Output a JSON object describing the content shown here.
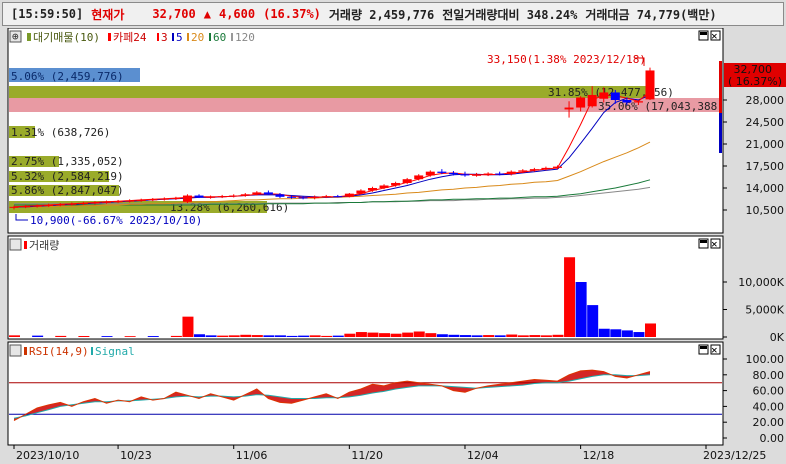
{
  "header": {
    "time": "[15:59:50]",
    "price_label": "현재가",
    "price": "32,700",
    "arrow": "▲",
    "change": "4,600",
    "change_pct": "(16.37%)",
    "volume": "거래량 2,459,776",
    "vol_ratio": "전일거래량대비 348.24%",
    "amount": "거래대금 74,779(백만)"
  },
  "price_pane": {
    "legend": [
      "대기매물(10)",
      "카페24",
      "3",
      "5",
      "20",
      "60",
      "120"
    ],
    "ylabels": [
      "28,000",
      "24,500",
      "21,000",
      "17,500",
      "14,000",
      "10,500"
    ],
    "current_price": "32,700",
    "current_pct": "( 16.37%)",
    "high_note": "33,150(1.38% 2023/12/18)",
    "low_note": "10,900(-66.67% 2023/10/10)",
    "supply_bars": [
      {
        "label": "5.06% (2,459,776)"
      },
      {
        "label": "31.85% (12,477,056)"
      },
      {
        "label": "35.06% (17,043,388)"
      },
      {
        "label": "1.31% (638,726)"
      },
      {
        "label": "2.75% (1,335,052)"
      },
      {
        "label": "5.32% (2,584,219)"
      },
      {
        "label": "5.86% (2,847,047)"
      },
      {
        "label": "13.28% (6,260,616)"
      }
    ],
    "candles": [
      [
        10.9,
        11.2,
        10.6,
        11.0
      ],
      [
        11.0,
        11.3,
        10.8,
        11.1
      ],
      [
        11.1,
        11.4,
        10.9,
        11.2
      ],
      [
        11.2,
        11.5,
        11.0,
        11.3
      ],
      [
        11.3,
        11.6,
        11.1,
        11.4
      ],
      [
        11.4,
        11.7,
        11.2,
        11.5
      ],
      [
        11.5,
        11.8,
        11.3,
        11.6
      ],
      [
        11.6,
        11.9,
        11.4,
        11.7
      ],
      [
        11.7,
        12.0,
        11.5,
        11.8
      ],
      [
        11.8,
        12.1,
        11.6,
        11.9
      ],
      [
        11.9,
        12.2,
        11.7,
        12.0
      ],
      [
        12.0,
        12.3,
        11.8,
        12.1
      ],
      [
        12.1,
        12.4,
        11.9,
        12.2
      ],
      [
        12.2,
        12.5,
        12.0,
        12.3
      ],
      [
        12.3,
        12.6,
        12.1,
        12.4
      ],
      [
        11.8,
        13.0,
        11.6,
        12.8
      ],
      [
        12.8,
        13.0,
        12.4,
        12.5
      ],
      [
        12.5,
        12.8,
        12.3,
        12.6
      ],
      [
        12.6,
        12.9,
        12.4,
        12.7
      ],
      [
        12.7,
        13.0,
        12.5,
        12.8
      ],
      [
        12.8,
        13.2,
        12.6,
        13.0
      ],
      [
        13.0,
        13.5,
        12.8,
        13.3
      ],
      [
        13.3,
        13.6,
        12.9,
        13.0
      ],
      [
        13.0,
        13.2,
        12.4,
        12.6
      ],
      [
        12.6,
        12.8,
        12.3,
        12.5
      ],
      [
        12.5,
        12.7,
        12.2,
        12.4
      ],
      [
        12.4,
        12.8,
        12.2,
        12.6
      ],
      [
        12.6,
        12.9,
        12.4,
        12.7
      ],
      [
        12.7,
        12.9,
        12.5,
        12.6
      ],
      [
        12.6,
        13.2,
        12.5,
        13.1
      ],
      [
        13.1,
        13.8,
        13.0,
        13.6
      ],
      [
        13.6,
        14.2,
        13.4,
        14.0
      ],
      [
        14.0,
        14.6,
        13.8,
        14.4
      ],
      [
        14.4,
        15.0,
        14.2,
        14.8
      ],
      [
        14.8,
        15.6,
        14.6,
        15.4
      ],
      [
        15.4,
        16.2,
        15.2,
        16.0
      ],
      [
        16.0,
        16.8,
        15.8,
        16.6
      ],
      [
        16.6,
        17.0,
        16.2,
        16.4
      ],
      [
        16.4,
        16.7,
        16.0,
        16.2
      ],
      [
        16.2,
        16.6,
        15.8,
        16.0
      ],
      [
        16.0,
        16.4,
        15.8,
        16.1
      ],
      [
        16.1,
        16.5,
        15.9,
        16.3
      ],
      [
        16.3,
        16.6,
        16.0,
        16.2
      ],
      [
        16.2,
        16.8,
        16.0,
        16.6
      ],
      [
        16.6,
        17.0,
        16.4,
        16.8
      ],
      [
        16.8,
        17.2,
        16.6,
        17.0
      ],
      [
        17.0,
        17.4,
        16.8,
        17.2
      ],
      [
        17.2,
        17.6,
        17.0,
        17.4
      ],
      [
        26.5,
        27.8,
        25.2,
        26.8
      ],
      [
        26.8,
        28.6,
        26.2,
        28.4
      ],
      [
        27.0,
        30.2,
        26.8,
        28.8
      ],
      [
        28.2,
        30.0,
        27.6,
        29.2
      ],
      [
        29.2,
        29.6,
        27.4,
        28.0
      ],
      [
        28.0,
        28.4,
        27.2,
        27.6
      ],
      [
        27.6,
        27.9,
        27.2,
        27.8
      ],
      [
        28.1,
        33.15,
        28.0,
        32.7
      ]
    ],
    "ma3": [
      11.0,
      11.1,
      11.2,
      11.3,
      11.4,
      11.5,
      11.6,
      11.7,
      11.8,
      11.9,
      12.0,
      12.1,
      12.2,
      12.3,
      12.4,
      12.5,
      12.6,
      12.6,
      12.6,
      12.7,
      12.8,
      13.0,
      13.1,
      13.0,
      12.7,
      12.5,
      12.5,
      12.6,
      12.6,
      12.8,
      13.1,
      13.6,
      14.0,
      14.4,
      14.9,
      15.4,
      16.0,
      16.3,
      16.4,
      16.2,
      16.1,
      16.1,
      16.2,
      16.4,
      16.5,
      16.8,
      17.0,
      17.2,
      20.5,
      24.1,
      28.0,
      28.8,
      28.7,
      28.3,
      27.8,
      29.4
    ],
    "ma5": [
      11.0,
      11.0,
      11.1,
      11.2,
      11.3,
      11.4,
      11.5,
      11.6,
      11.7,
      11.8,
      11.9,
      12.0,
      12.1,
      12.2,
      12.3,
      12.4,
      12.5,
      12.5,
      12.6,
      12.7,
      12.8,
      12.9,
      12.9,
      12.9,
      12.8,
      12.7,
      12.6,
      12.5,
      12.6,
      12.7,
      12.9,
      13.2,
      13.6,
      14.0,
      14.4,
      14.9,
      15.4,
      15.8,
      16.1,
      16.2,
      16.2,
      16.1,
      16.1,
      16.2,
      16.4,
      16.6,
      16.8,
      17.0,
      18.8,
      21.1,
      23.5,
      26.0,
      27.6,
      28.3,
      28.0,
      28.8
    ],
    "ma20": [
      11.0,
      11.0,
      11.0,
      11.0,
      11.1,
      11.1,
      11.2,
      11.2,
      11.3,
      11.3,
      11.4,
      11.4,
      11.5,
      11.5,
      11.6,
      11.7,
      11.8,
      11.8,
      11.9,
      12.0,
      12.1,
      12.1,
      12.2,
      12.3,
      12.3,
      12.4,
      12.4,
      12.5,
      12.5,
      12.6,
      12.7,
      12.8,
      12.9,
      13.0,
      13.2,
      13.3,
      13.5,
      13.7,
      13.8,
      14.0,
      14.1,
      14.3,
      14.4,
      14.6,
      14.7,
      14.9,
      15.0,
      15.2,
      15.9,
      16.6,
      17.4,
      18.2,
      18.9,
      19.6,
      20.4,
      21.3
    ],
    "ma60": [
      11.3,
      11.3,
      11.3,
      11.3,
      11.3,
      11.3,
      11.3,
      11.3,
      11.3,
      11.3,
      11.3,
      11.3,
      11.3,
      11.3,
      11.3,
      11.3,
      11.3,
      11.4,
      11.4,
      11.4,
      11.4,
      11.4,
      11.5,
      11.5,
      11.5,
      11.5,
      11.6,
      11.6,
      11.6,
      11.7,
      11.7,
      11.8,
      11.8,
      11.9,
      11.9,
      12.0,
      12.1,
      12.1,
      12.2,
      12.2,
      12.3,
      12.3,
      12.4,
      12.4,
      12.5,
      12.6,
      12.6,
      12.7,
      12.9,
      13.1,
      13.4,
      13.7,
      14.0,
      14.4,
      14.8,
      15.3
    ],
    "ma120": [
      11.5,
      11.5,
      11.5,
      11.5,
      11.5,
      11.5,
      11.5,
      11.5,
      11.5,
      11.5,
      11.5,
      11.5,
      11.5,
      11.5,
      11.5,
      11.5,
      11.5,
      11.5,
      11.5,
      11.5,
      11.5,
      11.5,
      11.6,
      11.6,
      11.6,
      11.6,
      11.6,
      11.6,
      11.7,
      11.7,
      11.7,
      11.8,
      11.8,
      11.8,
      11.9,
      11.9,
      12.0,
      12.0,
      12.0,
      12.1,
      12.1,
      12.2,
      12.2,
      12.3,
      12.3,
      12.4,
      12.4,
      12.5,
      12.6,
      12.8,
      13.0,
      13.2,
      13.4,
      13.6,
      13.8,
      14.1
    ]
  },
  "volume_pane": {
    "title": "거래량",
    "ylabels": [
      "10,000K",
      "5,000K",
      "0K"
    ],
    "bars": [
      {
        "i": 0,
        "v": 300,
        "up": true
      },
      {
        "i": 2,
        "v": 250,
        "up": false
      },
      {
        "i": 4,
        "v": 200,
        "up": true
      },
      {
        "i": 6,
        "v": 180,
        "up": true
      },
      {
        "i": 8,
        "v": 160,
        "up": false
      },
      {
        "i": 10,
        "v": 150,
        "up": true
      },
      {
        "i": 12,
        "v": 170,
        "up": false
      },
      {
        "i": 14,
        "v": 200,
        "up": true
      },
      {
        "i": 15,
        "v": 3700,
        "up": true
      },
      {
        "i": 16,
        "v": 500,
        "up": false
      },
      {
        "i": 17,
        "v": 300,
        "up": false
      },
      {
        "i": 18,
        "v": 250,
        "up": true
      },
      {
        "i": 19,
        "v": 300,
        "up": true
      },
      {
        "i": 20,
        "v": 400,
        "up": true
      },
      {
        "i": 21,
        "v": 350,
        "up": true
      },
      {
        "i": 22,
        "v": 300,
        "up": false
      },
      {
        "i": 23,
        "v": 300,
        "up": false
      },
      {
        "i": 24,
        "v": 200,
        "up": false
      },
      {
        "i": 25,
        "v": 250,
        "up": false
      },
      {
        "i": 26,
        "v": 300,
        "up": true
      },
      {
        "i": 27,
        "v": 200,
        "up": true
      },
      {
        "i": 28,
        "v": 250,
        "up": false
      },
      {
        "i": 29,
        "v": 600,
        "up": true
      },
      {
        "i": 30,
        "v": 900,
        "up": true
      },
      {
        "i": 31,
        "v": 800,
        "up": true
      },
      {
        "i": 32,
        "v": 700,
        "up": true
      },
      {
        "i": 33,
        "v": 600,
        "up": true
      },
      {
        "i": 34,
        "v": 800,
        "up": true
      },
      {
        "i": 35,
        "v": 1000,
        "up": true
      },
      {
        "i": 36,
        "v": 700,
        "up": true
      },
      {
        "i": 37,
        "v": 500,
        "up": false
      },
      {
        "i": 38,
        "v": 400,
        "up": false
      },
      {
        "i": 39,
        "v": 350,
        "up": false
      },
      {
        "i": 40,
        "v": 300,
        "up": false
      },
      {
        "i": 41,
        "v": 350,
        "up": true
      },
      {
        "i": 42,
        "v": 300,
        "up": false
      },
      {
        "i": 43,
        "v": 450,
        "up": true
      },
      {
        "i": 44,
        "v": 300,
        "up": true
      },
      {
        "i": 45,
        "v": 350,
        "up": true
      },
      {
        "i": 46,
        "v": 300,
        "up": true
      },
      {
        "i": 47,
        "v": 400,
        "up": true
      },
      {
        "i": 48,
        "v": 14500,
        "up": true
      },
      {
        "i": 49,
        "v": 10000,
        "up": false
      },
      {
        "i": 50,
        "v": 5800,
        "up": false
      },
      {
        "i": 51,
        "v": 1500,
        "up": false
      },
      {
        "i": 52,
        "v": 1400,
        "up": false
      },
      {
        "i": 53,
        "v": 1200,
        "up": false
      },
      {
        "i": 54,
        "v": 900,
        "up": false
      },
      {
        "i": 55,
        "v": 2459,
        "up": true
      }
    ]
  },
  "rsi_pane": {
    "title": "RSI(14,9)",
    "signal": "Signal",
    "ylabels": [
      "100.00",
      "80.00",
      "60.00",
      "40.00",
      "20.00",
      "0.00"
    ],
    "rsi": [
      22,
      30,
      38,
      42,
      45,
      40,
      46,
      50,
      44,
      48,
      46,
      52,
      48,
      50,
      58,
      54,
      50,
      56,
      52,
      48,
      55,
      62,
      50,
      45,
      44,
      48,
      52,
      56,
      50,
      58,
      62,
      68,
      66,
      70,
      72,
      70,
      68,
      66,
      60,
      58,
      63,
      66,
      68,
      70,
      72,
      74,
      73,
      72,
      80,
      85,
      86,
      84,
      78,
      76,
      80,
      84
    ],
    "signal_vals": [
      25,
      28,
      32,
      36,
      40,
      42,
      44,
      46,
      46,
      47,
      47,
      48,
      49,
      50,
      52,
      53,
      52,
      53,
      53,
      52,
      53,
      55,
      54,
      52,
      50,
      50,
      50,
      51,
      51,
      52,
      54,
      57,
      59,
      62,
      64,
      66,
      66,
      66,
      65,
      64,
      63,
      64,
      65,
      66,
      67,
      69,
      70,
      70,
      72,
      75,
      78,
      80,
      80,
      79,
      79,
      80
    ]
  },
  "xaxis": [
    "2023/10/10",
    "10/23",
    "11/06",
    "11/20",
    "12/04",
    "12/18",
    "2023/12/25"
  ],
  "colors": {
    "up": "#ff0000",
    "down": "#0000ff",
    "ma3": "#ff0000",
    "ma5": "#0000c0",
    "ma20": "#d98a1a",
    "ma60": "#1a7a3a",
    "ma120": "#888888",
    "pane_border": "#000000"
  }
}
